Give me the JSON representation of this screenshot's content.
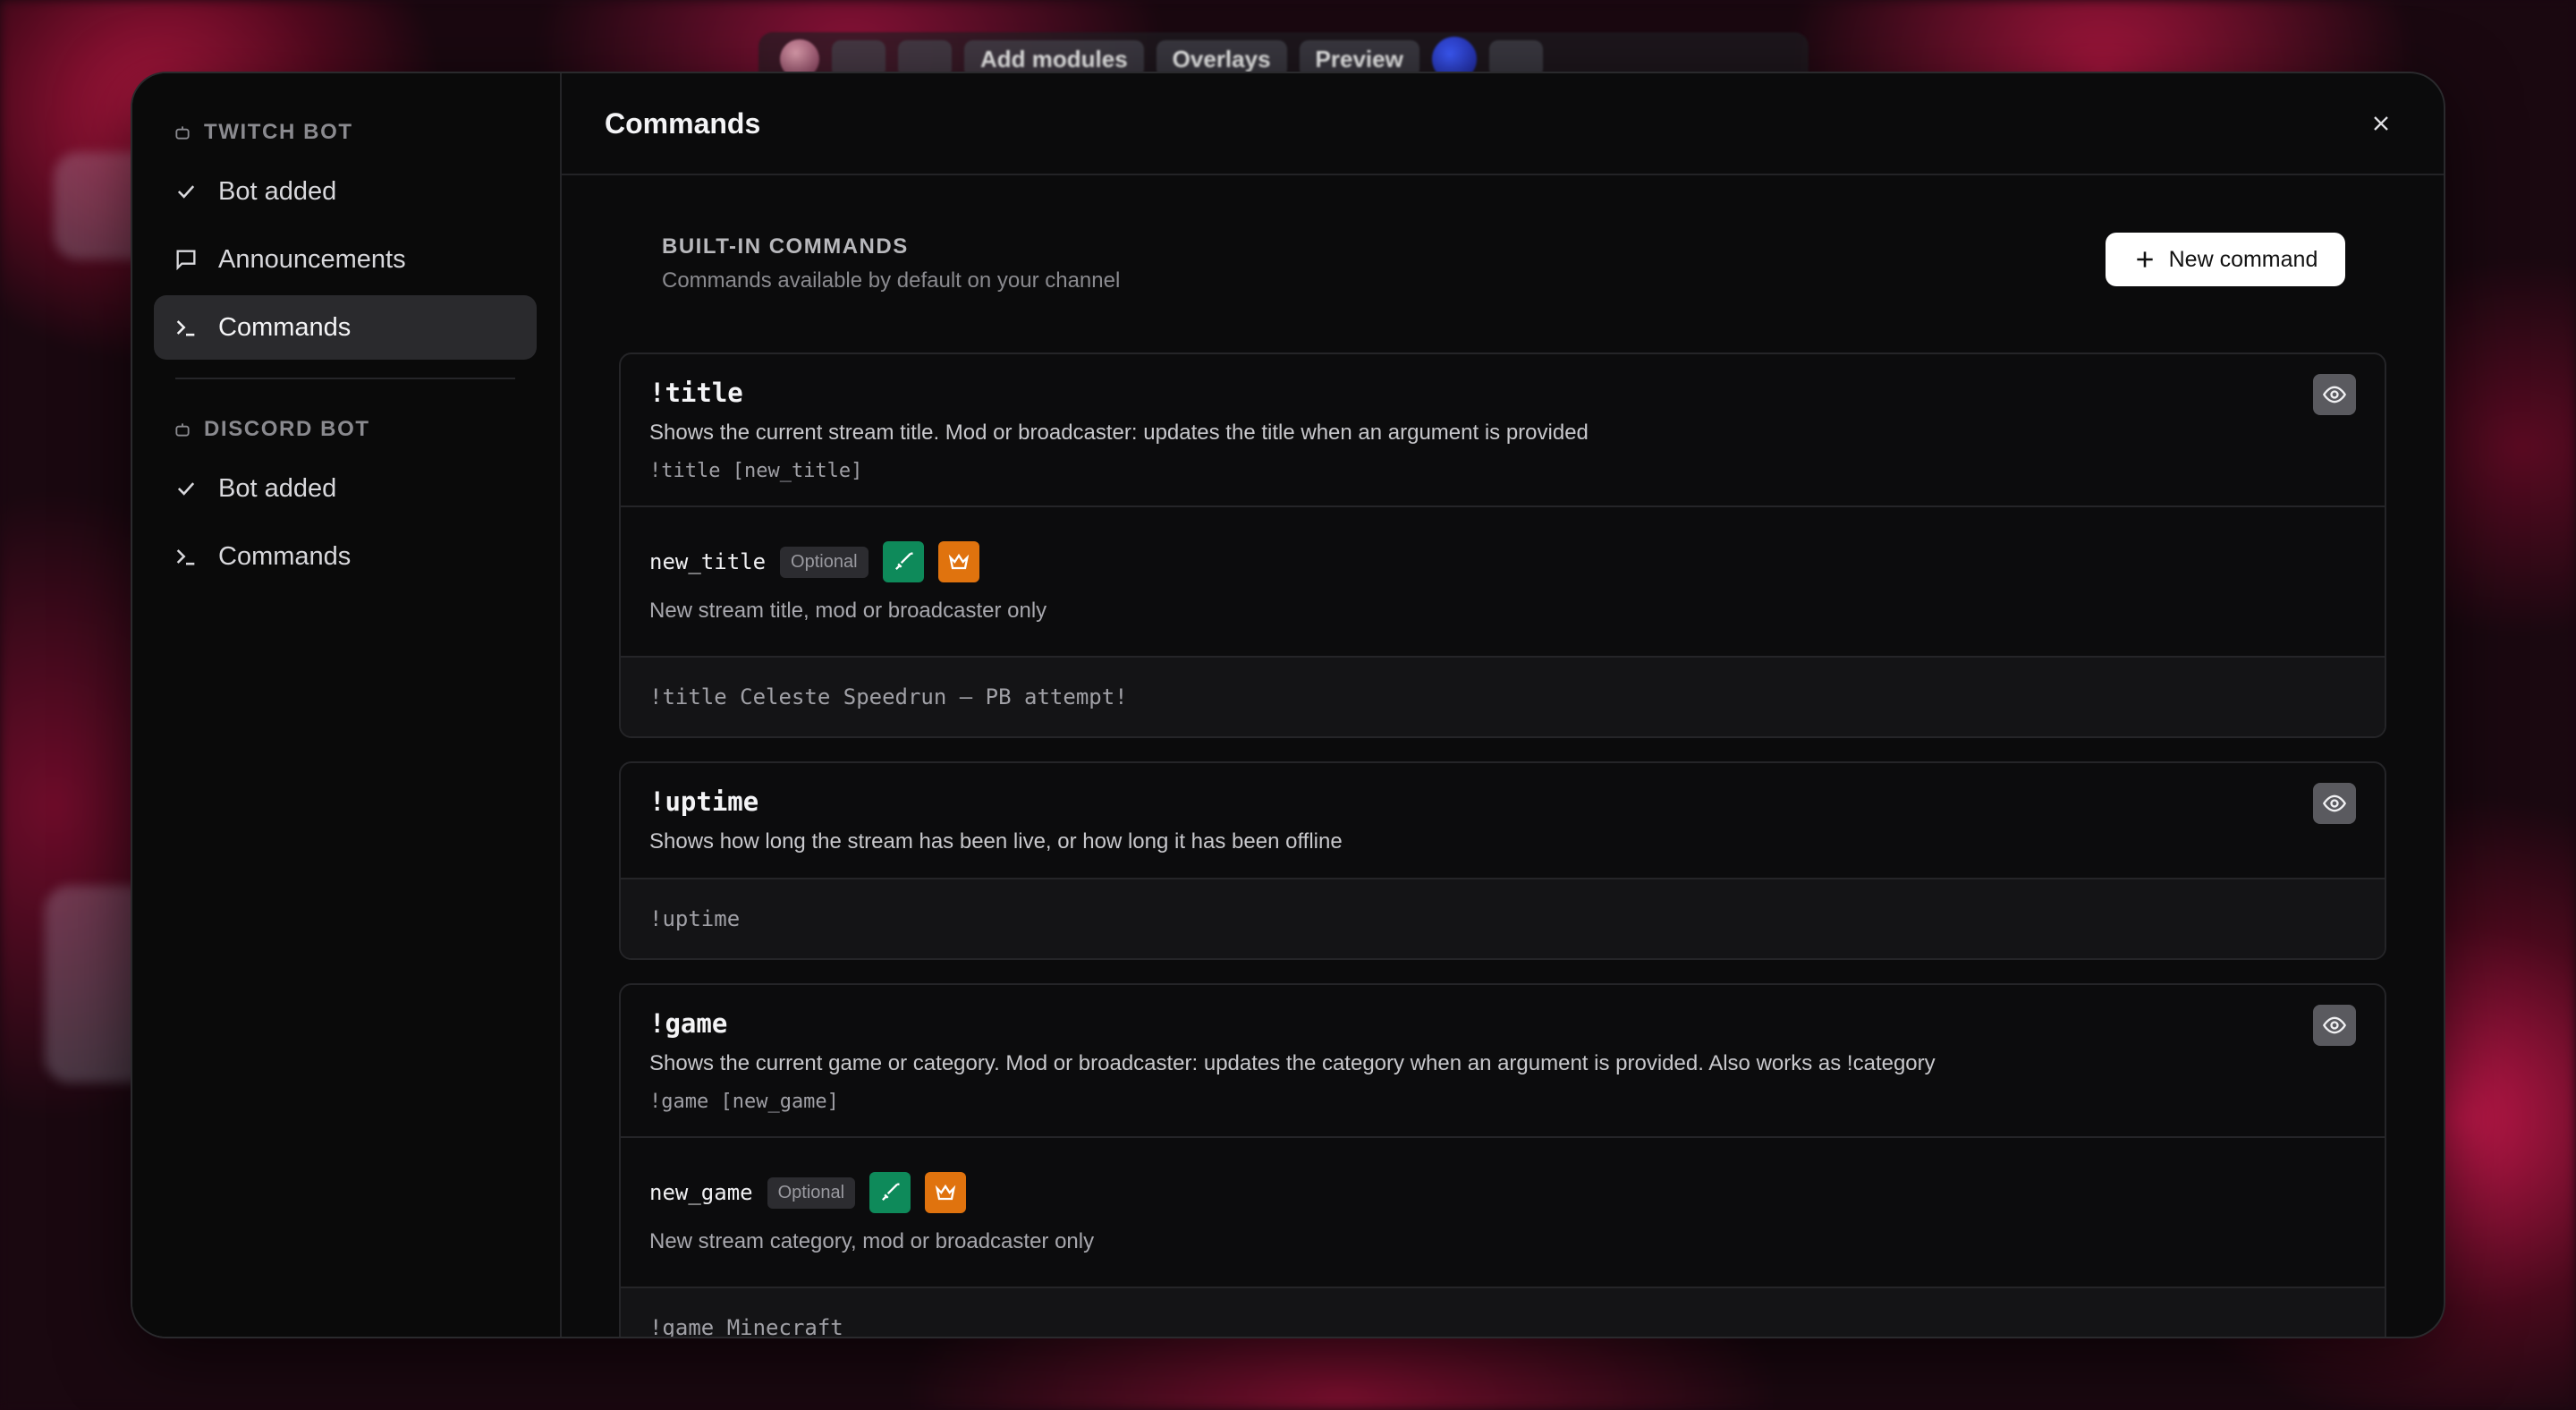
{
  "sidebar": {
    "sections": [
      {
        "title": "TWITCH BOT",
        "items": [
          {
            "label": "Bot added",
            "icon": "check-icon"
          },
          {
            "label": "Announcements",
            "icon": "message-icon"
          },
          {
            "label": "Commands",
            "icon": "terminal-icon",
            "active": true
          }
        ]
      },
      {
        "title": "DISCORD BOT",
        "items": [
          {
            "label": "Bot added",
            "icon": "check-icon"
          },
          {
            "label": "Commands",
            "icon": "terminal-icon"
          }
        ]
      }
    ]
  },
  "header": {
    "title": "Commands"
  },
  "section": {
    "title": "BUILT-IN COMMANDS",
    "subtitle": "Commands available by default on your channel",
    "new_button_label": "New command"
  },
  "commands": [
    {
      "name": "!title",
      "description": "Shows the current stream title. Mod or broadcaster: updates the title when an argument is provided",
      "usage": "!title [new_title]",
      "argument": {
        "name": "new_title",
        "badge": "Optional",
        "description": "New stream title, mod or broadcaster only"
      },
      "example": "!title Celeste Speedrun — PB attempt!"
    },
    {
      "name": "!uptime",
      "description": "Shows how long the stream has been live, or how long it has been offline",
      "example": "!uptime"
    },
    {
      "name": "!game",
      "description": "Shows the current game or category. Mod or broadcaster: updates the category when an argument is provided. Also works as !category",
      "usage": "!game [new_game]",
      "argument": {
        "name": "new_game",
        "badge": "Optional",
        "description": "New stream category, mod or broadcaster only"
      },
      "example": "!game Minecraft"
    }
  ],
  "topbar": {
    "add_modules_label": "Add modules",
    "overlays_label": "Overlays",
    "preview_label": "Preview"
  },
  "colors": {
    "mod_badge": "#0e8a5a",
    "broadcaster_badge": "#e0730e",
    "active_nav": "#2a2a2d"
  }
}
